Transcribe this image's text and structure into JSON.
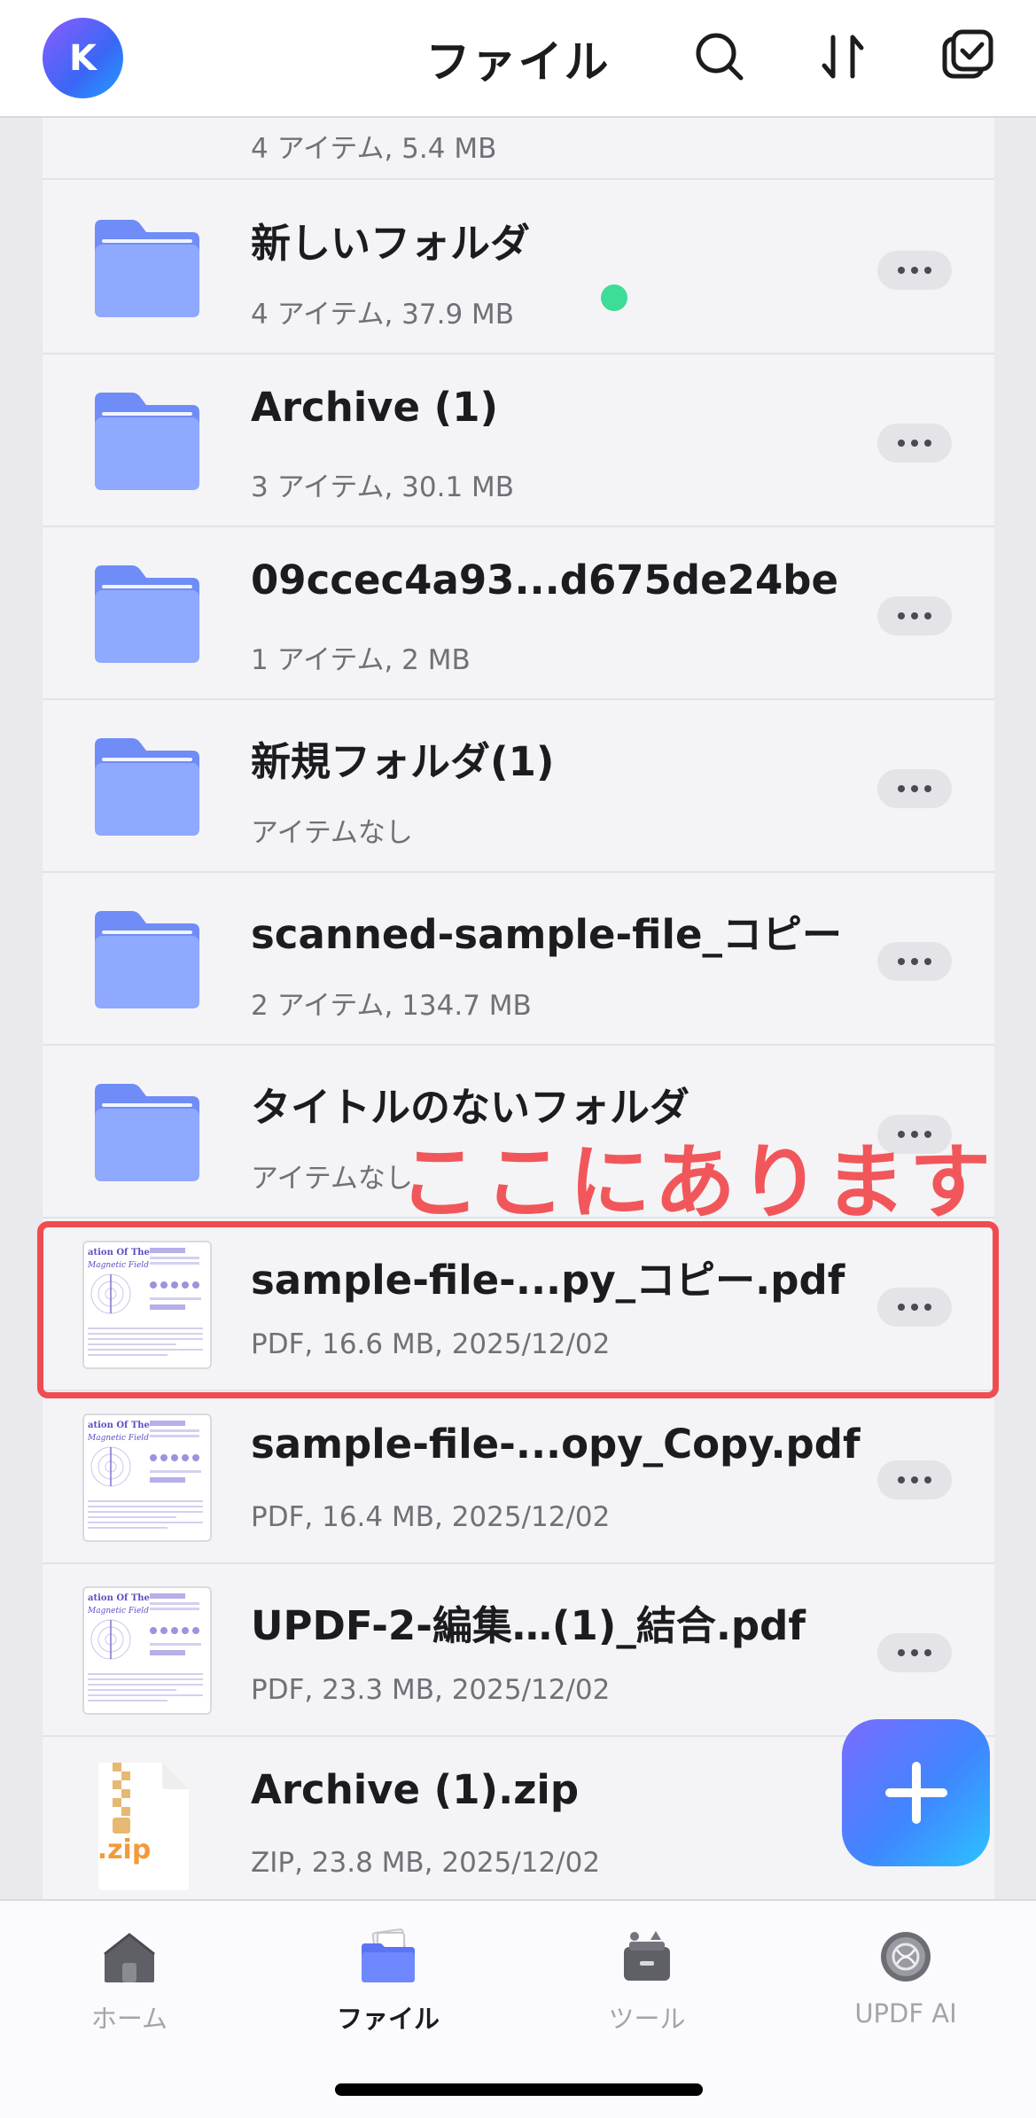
{
  "header": {
    "avatar_letter": "K",
    "title": "ファイル",
    "icons": [
      "search-icon",
      "sort-icon",
      "select-icon"
    ]
  },
  "files": [
    {
      "kind": "folder-green",
      "title": "",
      "meta": "4 アイテム, 5.4 MB",
      "has_more": false
    },
    {
      "kind": "folder",
      "title": "新しいフォルダ",
      "meta": "4 アイテム, 37.9 MB",
      "has_more": true,
      "sync_dot": true
    },
    {
      "kind": "folder",
      "title": "Archive (1)",
      "meta": "3 アイテム, 30.1 MB",
      "has_more": true
    },
    {
      "kind": "folder",
      "title": " 09ccec4a93...d675de24be",
      "meta": "1 アイテム, 2 MB",
      "has_more": true
    },
    {
      "kind": "folder",
      "title": "新規フォルダ(1)",
      "meta": "アイテムなし",
      "has_more": true
    },
    {
      "kind": "folder",
      "title": "scanned-sample-file_コピー",
      "meta": "2 アイテム, 134.7 MB",
      "has_more": true
    },
    {
      "kind": "folder",
      "title": "タイトルのないフォルダ",
      "meta": "アイテムなし",
      "has_more": true
    },
    {
      "kind": "pdf",
      "title": "sample-file-...py_コピー.pdf",
      "meta": "PDF, 16.6 MB, 2025/12/02",
      "has_more": true,
      "highlighted": true
    },
    {
      "kind": "pdf",
      "title": "sample-file-...opy_Copy.pdf",
      "meta": "PDF, 16.4 MB, 2025/12/02",
      "has_more": true
    },
    {
      "kind": "pdf",
      "title": " UPDF-2-編集…(1)_結合.pdf",
      "meta": "PDF, 23.3 MB, 2025/12/02",
      "has_more": true
    },
    {
      "kind": "zip",
      "title": "Archive (1).zip",
      "meta": "ZIP, 23.8 MB, 2025/12/02",
      "has_more": false,
      "ext_label": ".zip"
    }
  ],
  "pdf_thumb_text": {
    "line1": "ation Of The",
    "line2": "Magnetic Field"
  },
  "annotation": {
    "text": "ここにあります",
    "color": "#f1575a"
  },
  "fab": {
    "icon": "plus-icon"
  },
  "tabbar": [
    {
      "label": "ホーム",
      "icon": "home-icon",
      "active": false
    },
    {
      "label": "ファイル",
      "icon": "folder-tab-icon",
      "active": true
    },
    {
      "label": "ツール",
      "icon": "toolbox-icon",
      "active": false
    },
    {
      "label": "UPDF AI",
      "icon": "ai-icon",
      "active": false
    }
  ],
  "colors": {
    "accent": "#3a67f5",
    "folder": "#7e9bff",
    "highlight": "#f04c4f",
    "green_dot": "#3ddc97"
  }
}
